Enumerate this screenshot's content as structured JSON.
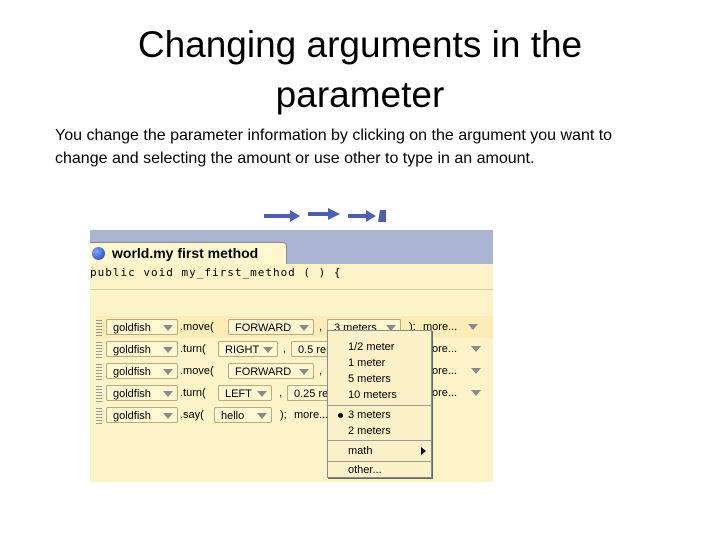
{
  "slide": {
    "title_line1": "Changing arguments in the",
    "title_line2": "parameter",
    "body": "You change the parameter information by clicking on the argument you want to change and selecting the amount or use other to type in an amount."
  },
  "editor": {
    "tab_label": "world.my first method",
    "signature": "public void my_first_method ( ) {",
    "rows": [
      {
        "object": "goldfish",
        "method": ".move(",
        "arg1": "FORWARD",
        "sep": ",",
        "arg2": "3 meters",
        "close": ");",
        "more": "more..."
      },
      {
        "object": "goldfish",
        "method": ".turn(",
        "arg1": "RIGHT",
        "sep": ",",
        "arg2": "0.5 re",
        "more": "ore..."
      },
      {
        "object": "goldfish",
        "method": ".move(",
        "arg1": "FORWARD",
        "sep": ",",
        "more": "ore..."
      },
      {
        "object": "goldfish",
        "method": ".turn(",
        "arg1": "LEFT",
        "sep": ",",
        "arg2": "0.25 re",
        "more": "ore..."
      },
      {
        "object": "goldfish",
        "method": ".say(",
        "arg1": "hello",
        "close": ");",
        "more": "more..."
      }
    ]
  },
  "dropdown": {
    "items": [
      "1/2 meter",
      "1 meter",
      "5 meters",
      "10 meters",
      "3 meters",
      "2 meters",
      "math",
      "other..."
    ],
    "selected_index": 4
  },
  "colors": {
    "editor_bg": "#fdf3c8",
    "tab_strip": "#a9b4d3",
    "tile_bg": "#fff6d2"
  }
}
